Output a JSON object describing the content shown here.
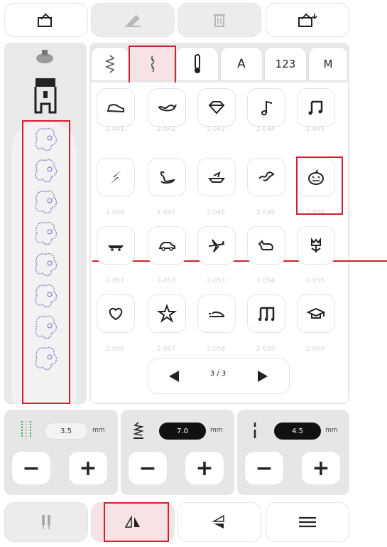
{
  "toolbar": {
    "icons": [
      "home-screen-icon",
      "eraser-icon",
      "trash-icon",
      "save-icon"
    ]
  },
  "tabs": [
    {
      "label": "",
      "icon": "zigzag-stitch-icon"
    },
    {
      "label": "",
      "icon": "decorative-stitch-icon",
      "active": true
    },
    {
      "label": "",
      "icon": "quilt-stitch-icon"
    },
    {
      "label": "A"
    },
    {
      "label": "123"
    },
    {
      "label": "M"
    }
  ],
  "stitches": [
    {
      "icon": "shoe-icon",
      "number": "2-041"
    },
    {
      "icon": "whale-icon",
      "number": "2-042"
    },
    {
      "icon": "diamond-icon",
      "number": "2-043"
    },
    {
      "icon": "music-note-icon",
      "number": "2-044"
    },
    {
      "icon": "double-music-note-icon",
      "number": "2-045"
    },
    {
      "icon": "lightning-icon",
      "number": "2-046"
    },
    {
      "icon": "swan-icon",
      "number": "2-047"
    },
    {
      "icon": "boat-icon",
      "number": "2-048"
    },
    {
      "icon": "bird-icon",
      "number": "2-049"
    },
    {
      "icon": "pumpkin-icon",
      "number": "2-050"
    },
    {
      "icon": "train-icon",
      "number": "2-051"
    },
    {
      "icon": "car-icon",
      "number": "2-052"
    },
    {
      "icon": "airplane-icon",
      "number": "2-053"
    },
    {
      "icon": "cat-icon",
      "number": "2-054"
    },
    {
      "icon": "tulip-icon",
      "number": "2-055"
    },
    {
      "icon": "heart-icon",
      "number": "2-056"
    },
    {
      "icon": "star-icon",
      "number": "2-057"
    },
    {
      "icon": "turtle-icon",
      "number": "2-058"
    },
    {
      "icon": "triple-note-icon",
      "number": "2-059"
    },
    {
      "icon": "graduation-cap-icon",
      "number": "2-060"
    }
  ],
  "pagination": {
    "label": "3 / 3"
  },
  "settings": {
    "width": {
      "value": "3.5",
      "unit": "mm"
    },
    "length": {
      "value": "7.0",
      "unit": "mm"
    },
    "position": {
      "value": "4.5",
      "unit": "mm"
    }
  },
  "buttons": {
    "minus": "−",
    "plus": "+"
  },
  "bottom_bar": {
    "icons": [
      "twin-needle-icon",
      "mirror-horizontal-icon",
      "mirror-vertical-icon",
      "menu-icon"
    ]
  },
  "colors": {
    "highlight": "#d31f2b",
    "pattern": "#6d6dc9"
  }
}
